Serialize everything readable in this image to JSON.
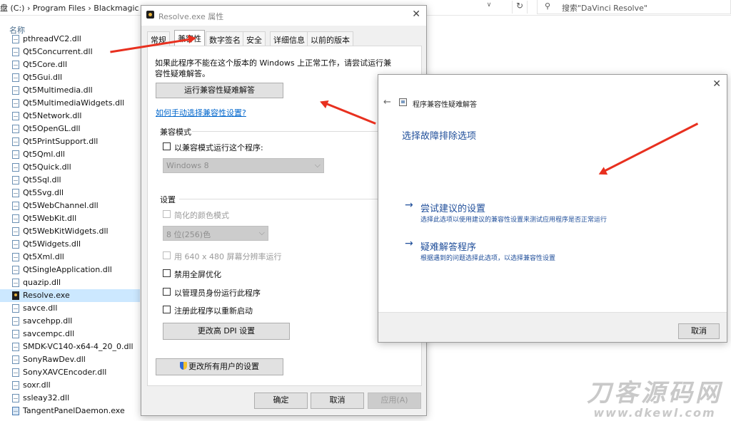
{
  "explorer": {
    "address_path": "盘 (C:)  ›  Program Files  ›  Blackmagic Design  ›  DaVinci Resolve",
    "address_dropdown": "∨",
    "refresh_glyph": "↻",
    "search_placeholder": "搜索\"DaVinci Resolve\"",
    "column_header": "名称",
    "files": [
      {
        "name": "pthreadVC2.dll",
        "type": "dll"
      },
      {
        "name": "Qt5Concurrent.dll",
        "type": "dll"
      },
      {
        "name": "Qt5Core.dll",
        "type": "dll"
      },
      {
        "name": "Qt5Gui.dll",
        "type": "dll"
      },
      {
        "name": "Qt5Multimedia.dll",
        "type": "dll"
      },
      {
        "name": "Qt5MultimediaWidgets.dll",
        "type": "dll"
      },
      {
        "name": "Qt5Network.dll",
        "type": "dll"
      },
      {
        "name": "Qt5OpenGL.dll",
        "type": "dll"
      },
      {
        "name": "Qt5PrintSupport.dll",
        "type": "dll"
      },
      {
        "name": "Qt5Qml.dll",
        "type": "dll"
      },
      {
        "name": "Qt5Quick.dll",
        "type": "dll"
      },
      {
        "name": "Qt5Sql.dll",
        "type": "dll"
      },
      {
        "name": "Qt5Svg.dll",
        "type": "dll"
      },
      {
        "name": "Qt5WebChannel.dll",
        "type": "dll"
      },
      {
        "name": "Qt5WebKit.dll",
        "type": "dll"
      },
      {
        "name": "Qt5WebKitWidgets.dll",
        "type": "dll"
      },
      {
        "name": "Qt5Widgets.dll",
        "type": "dll"
      },
      {
        "name": "Qt5Xml.dll",
        "type": "dll"
      },
      {
        "name": "QtSingleApplication.dll",
        "type": "dll"
      },
      {
        "name": "quazip.dll",
        "type": "dll"
      },
      {
        "name": "Resolve.exe",
        "type": "exe",
        "selected": true
      },
      {
        "name": "savce.dll",
        "type": "dll"
      },
      {
        "name": "savcehpp.dll",
        "type": "dll"
      },
      {
        "name": "savcempc.dll",
        "type": "dll"
      },
      {
        "name": "SMDK-VC140-x64-4_20_0.dll",
        "type": "dll"
      },
      {
        "name": "SonyRawDev.dll",
        "type": "dll"
      },
      {
        "name": "SonyXAVCEncoder.dll",
        "type": "dll"
      },
      {
        "name": "soxr.dll",
        "type": "dll"
      },
      {
        "name": "ssleay32.dll",
        "type": "dll"
      },
      {
        "name": "TangentPanelDaemon.exe",
        "type": "exe2"
      }
    ]
  },
  "properties": {
    "title": "Resolve.exe 属性",
    "close_glyph": "✕",
    "tabs": [
      "常规",
      "兼容性",
      "数字签名",
      "安全",
      "详细信息",
      "以前的版本"
    ],
    "intro": "如果此程序不能在这个版本的 Windows 上正常工作，请尝试运行兼",
    "intro2": "容性疑难解答。",
    "run_troubleshooter": "运行兼容性疑难解答",
    "manual_link": "如何手动选择兼容性设置?",
    "compat_mode_group": "兼容模式",
    "compat_mode_check": "以兼容模式运行这个程序:",
    "compat_os": "Windows 8",
    "settings_group": "设置",
    "reduced_color": "简化的颜色模式",
    "color_depth": "8 位(256)色",
    "res_640": "用 640 x 480 屏幕分辨率运行",
    "disable_fullscreen": "禁用全屏优化",
    "run_as_admin": "以管理员身份运行此程序",
    "register_restart": "注册此程序以重新启动",
    "change_dpi": "更改高 DPI 设置",
    "change_all_users": "更改所有用户的设置",
    "ok": "确定",
    "cancel": "取消",
    "apply": "应用(A)",
    "dropdown_glyph": "⌵"
  },
  "troubleshooter": {
    "close_glyph": "✕",
    "back_glyph": "←",
    "title": "程序兼容性疑难解答",
    "heading": "选择故障排除选项",
    "option_arrow": "→",
    "option1_title": "尝试建议的设置",
    "option1_desc": "选择此选项以使用建议的兼容性设置来测试应用程序是否正常运行",
    "option2_title": "疑难解答程序",
    "option2_desc": "根据遇到的问题选择此选项，以选择兼容性设置",
    "cancel": "取消"
  },
  "watermark": {
    "cn": "刀客源码网",
    "url": "www.dkewl.com"
  },
  "colors": {
    "annotation_arrow": "#e8301f",
    "link_blue": "#0066cc",
    "heading_blue": "#1f4e9a",
    "selected_row": "#cce8ff"
  }
}
